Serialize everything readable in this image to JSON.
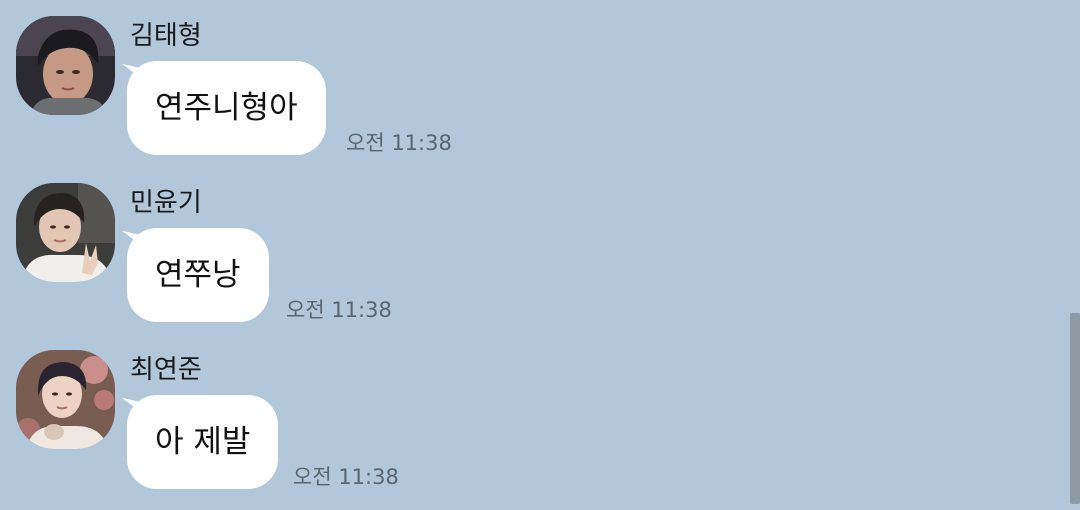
{
  "messages": [
    {
      "sender": "김태형",
      "text": "연주니형아",
      "time": "오전 11:38",
      "avatar_icon": "profile-photo-kim-taehyung"
    },
    {
      "sender": "민윤기",
      "text": "연쭈낭",
      "time": "오전 11:38",
      "avatar_icon": "profile-photo-min-yoongi"
    },
    {
      "sender": "최연준",
      "text": "아 제발",
      "time": "오전 11:38",
      "avatar_icon": "profile-photo-choi-yeonjun"
    }
  ],
  "colors": {
    "background": "#b2c7da",
    "bubble": "#ffffff",
    "timestamp": "#59666f",
    "scrollbar": "#8e9aa4"
  }
}
